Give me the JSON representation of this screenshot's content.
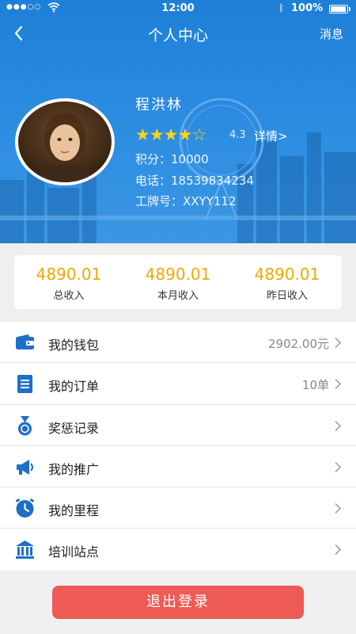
{
  "status_bar": {
    "signal": "●●●○○",
    "time": "12:00",
    "battery": "100%"
  },
  "nav": {
    "title": "个人中心",
    "right_action": "消息"
  },
  "profile": {
    "name": "程洪林",
    "rating_value": "4.3",
    "rating_stars": 4.3,
    "detail_link": "详情>",
    "points_line": "积分：10000",
    "phone_line": "电话：18539834234",
    "badge_line": "工牌号：XXYY112"
  },
  "stats": [
    {
      "value": "4890.01",
      "label": "总收入"
    },
    {
      "value": "4890.01",
      "label": "本月收入"
    },
    {
      "value": "4890.01",
      "label": "昨日收入"
    }
  ],
  "menu": [
    {
      "label": "我的钱包",
      "value": "2902.00元",
      "icon": "wallet-icon"
    },
    {
      "label": "我的订单",
      "value": "10单",
      "icon": "order-list-icon"
    },
    {
      "label": "奖惩记录",
      "value": "",
      "icon": "medal-icon"
    },
    {
      "label": "我的推广",
      "value": "",
      "icon": "megaphone-icon"
    },
    {
      "label": "我的里程",
      "value": "",
      "icon": "clock-icon"
    },
    {
      "label": "培训站点",
      "value": "",
      "icon": "building-icon"
    }
  ],
  "logout_label": "退出登录",
  "colors": {
    "header_blue": "#2a8be0",
    "accent_orange": "#f0a800",
    "icon_blue": "#1f6fc5",
    "logout_red": "#ee5a55",
    "star_yellow": "#ffd21a"
  }
}
